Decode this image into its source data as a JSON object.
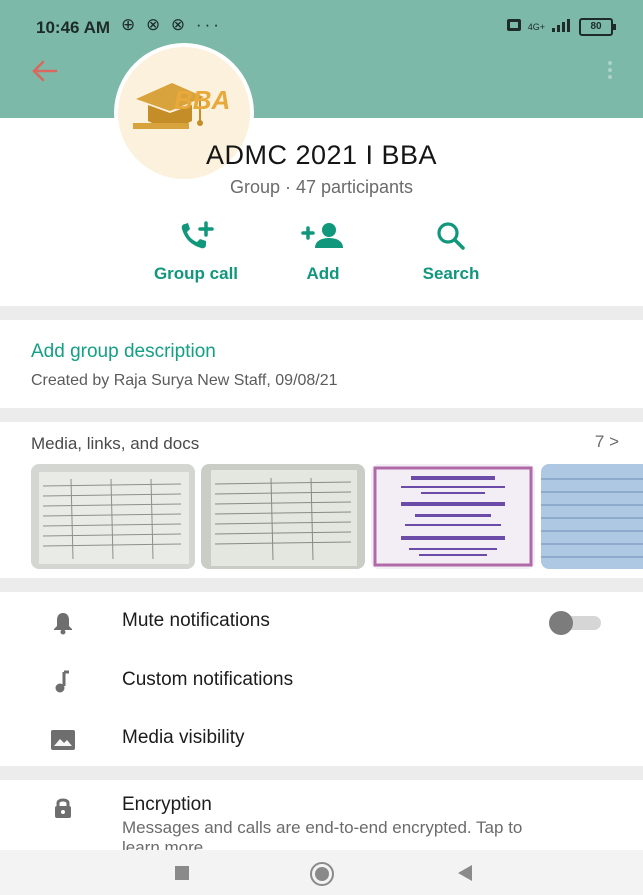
{
  "status_bar": {
    "time": "10:46 AM",
    "left_icons": "⊕ ⊗ ⊗ ···",
    "network": "4G+",
    "battery": "80"
  },
  "header": {
    "avatar_text": "BBA"
  },
  "group": {
    "name": "ADMC 2021 I BBA",
    "subtitle": "Group · 47 participants"
  },
  "actions": [
    {
      "label": "Group call",
      "icon": "add-call-icon"
    },
    {
      "label": "Add",
      "icon": "add-person-icon"
    },
    {
      "label": "Search",
      "icon": "search-icon"
    }
  ],
  "description": {
    "add_label": "Add group description",
    "created_by": "Created by Raja Surya New Staff, 09/08/21"
  },
  "media": {
    "title": "Media, links, and docs",
    "count": "7 >"
  },
  "settings": [
    {
      "label": "Mute notifications",
      "icon": "bell-icon",
      "toggle": false
    },
    {
      "label": "Custom notifications",
      "icon": "music-note-icon"
    },
    {
      "label": "Media visibility",
      "icon": "image-icon"
    }
  ],
  "encryption": {
    "title": "Encryption",
    "description": "Messages and calls are end-to-end encrypted. Tap to learn more."
  },
  "colors": {
    "header": "#7cb9a8",
    "accent": "#10977c",
    "link": "#13a083"
  }
}
